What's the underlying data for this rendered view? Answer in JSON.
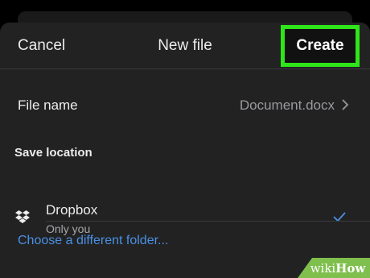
{
  "header": {
    "cancel_label": "Cancel",
    "title": "New file",
    "create_label": "Create"
  },
  "file_name_row": {
    "label": "File name",
    "value": "Document.docx"
  },
  "save_location": {
    "section_label": "Save location",
    "option": {
      "name": "Dropbox",
      "subtitle": "Only you",
      "selected": true
    },
    "choose_label": "Choose a different folder..."
  },
  "watermark": {
    "prefix": "wiki",
    "suffix": "How"
  },
  "colors": {
    "background": "#000000",
    "sheet": "#222223",
    "highlight": "#2ee51a",
    "link": "#4a90e2",
    "check": "#4a90e2",
    "watermark": "#7fbf4d"
  },
  "icons": {
    "chevron": "chevron-right-icon",
    "dropbox": "dropbox-icon",
    "check": "checkmark-icon"
  }
}
